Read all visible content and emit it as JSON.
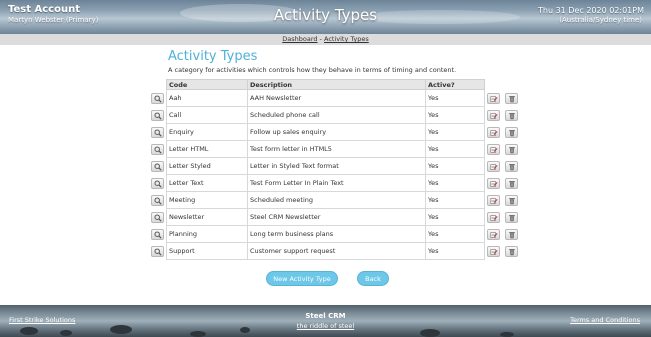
{
  "header": {
    "account": "Test Account",
    "user": "Martyn Webster (Primary)",
    "title": "Activity Types",
    "date": "Thu 31 Dec 2020 02:01PM",
    "timezone": "(Australia/Sydney time)"
  },
  "breadcrumb": {
    "home": "Dashboard",
    "sep": " - ",
    "current": "Activity Types"
  },
  "main": {
    "title": "Activity Types",
    "description": "A category for activities which controls how they behave in terms of timing and content."
  },
  "table": {
    "headers": {
      "code": "Code",
      "description": "Description",
      "active": "Active?"
    },
    "rows": [
      {
        "code": "Aah",
        "description": "AAH Newsletter",
        "active": "Yes"
      },
      {
        "code": "Call",
        "description": "Scheduled phone call",
        "active": "Yes"
      },
      {
        "code": "Enquiry",
        "description": "Follow up sales enquiry",
        "active": "Yes"
      },
      {
        "code": "Letter HTML",
        "description": "Test form letter in HTML5",
        "active": "Yes"
      },
      {
        "code": "Letter Styled",
        "description": "Letter in Styled Text format",
        "active": "Yes"
      },
      {
        "code": "Letter Text",
        "description": "Test Form Letter In Plain Text",
        "active": "Yes"
      },
      {
        "code": "Meeting",
        "description": "Scheduled meeting",
        "active": "Yes"
      },
      {
        "code": "Newsletter",
        "description": "Steel CRM Newsletter",
        "active": "Yes"
      },
      {
        "code": "Planning",
        "description": "Long term business plans",
        "active": "Yes"
      },
      {
        "code": "Support",
        "description": "Customer support request",
        "active": "Yes"
      }
    ]
  },
  "buttons": {
    "new": "New Activity Type",
    "back": "Back"
  },
  "footer": {
    "company": "First Strike Solutions",
    "product": "Steel CRM",
    "tagline": "the riddle of steel",
    "terms": "Terms and Conditions"
  },
  "colors": {
    "accent": "#4fb0da",
    "button": "#6cc7e8"
  },
  "icons": {
    "view": "magnifier-icon",
    "edit": "edit-icon",
    "delete": "trash-icon"
  }
}
